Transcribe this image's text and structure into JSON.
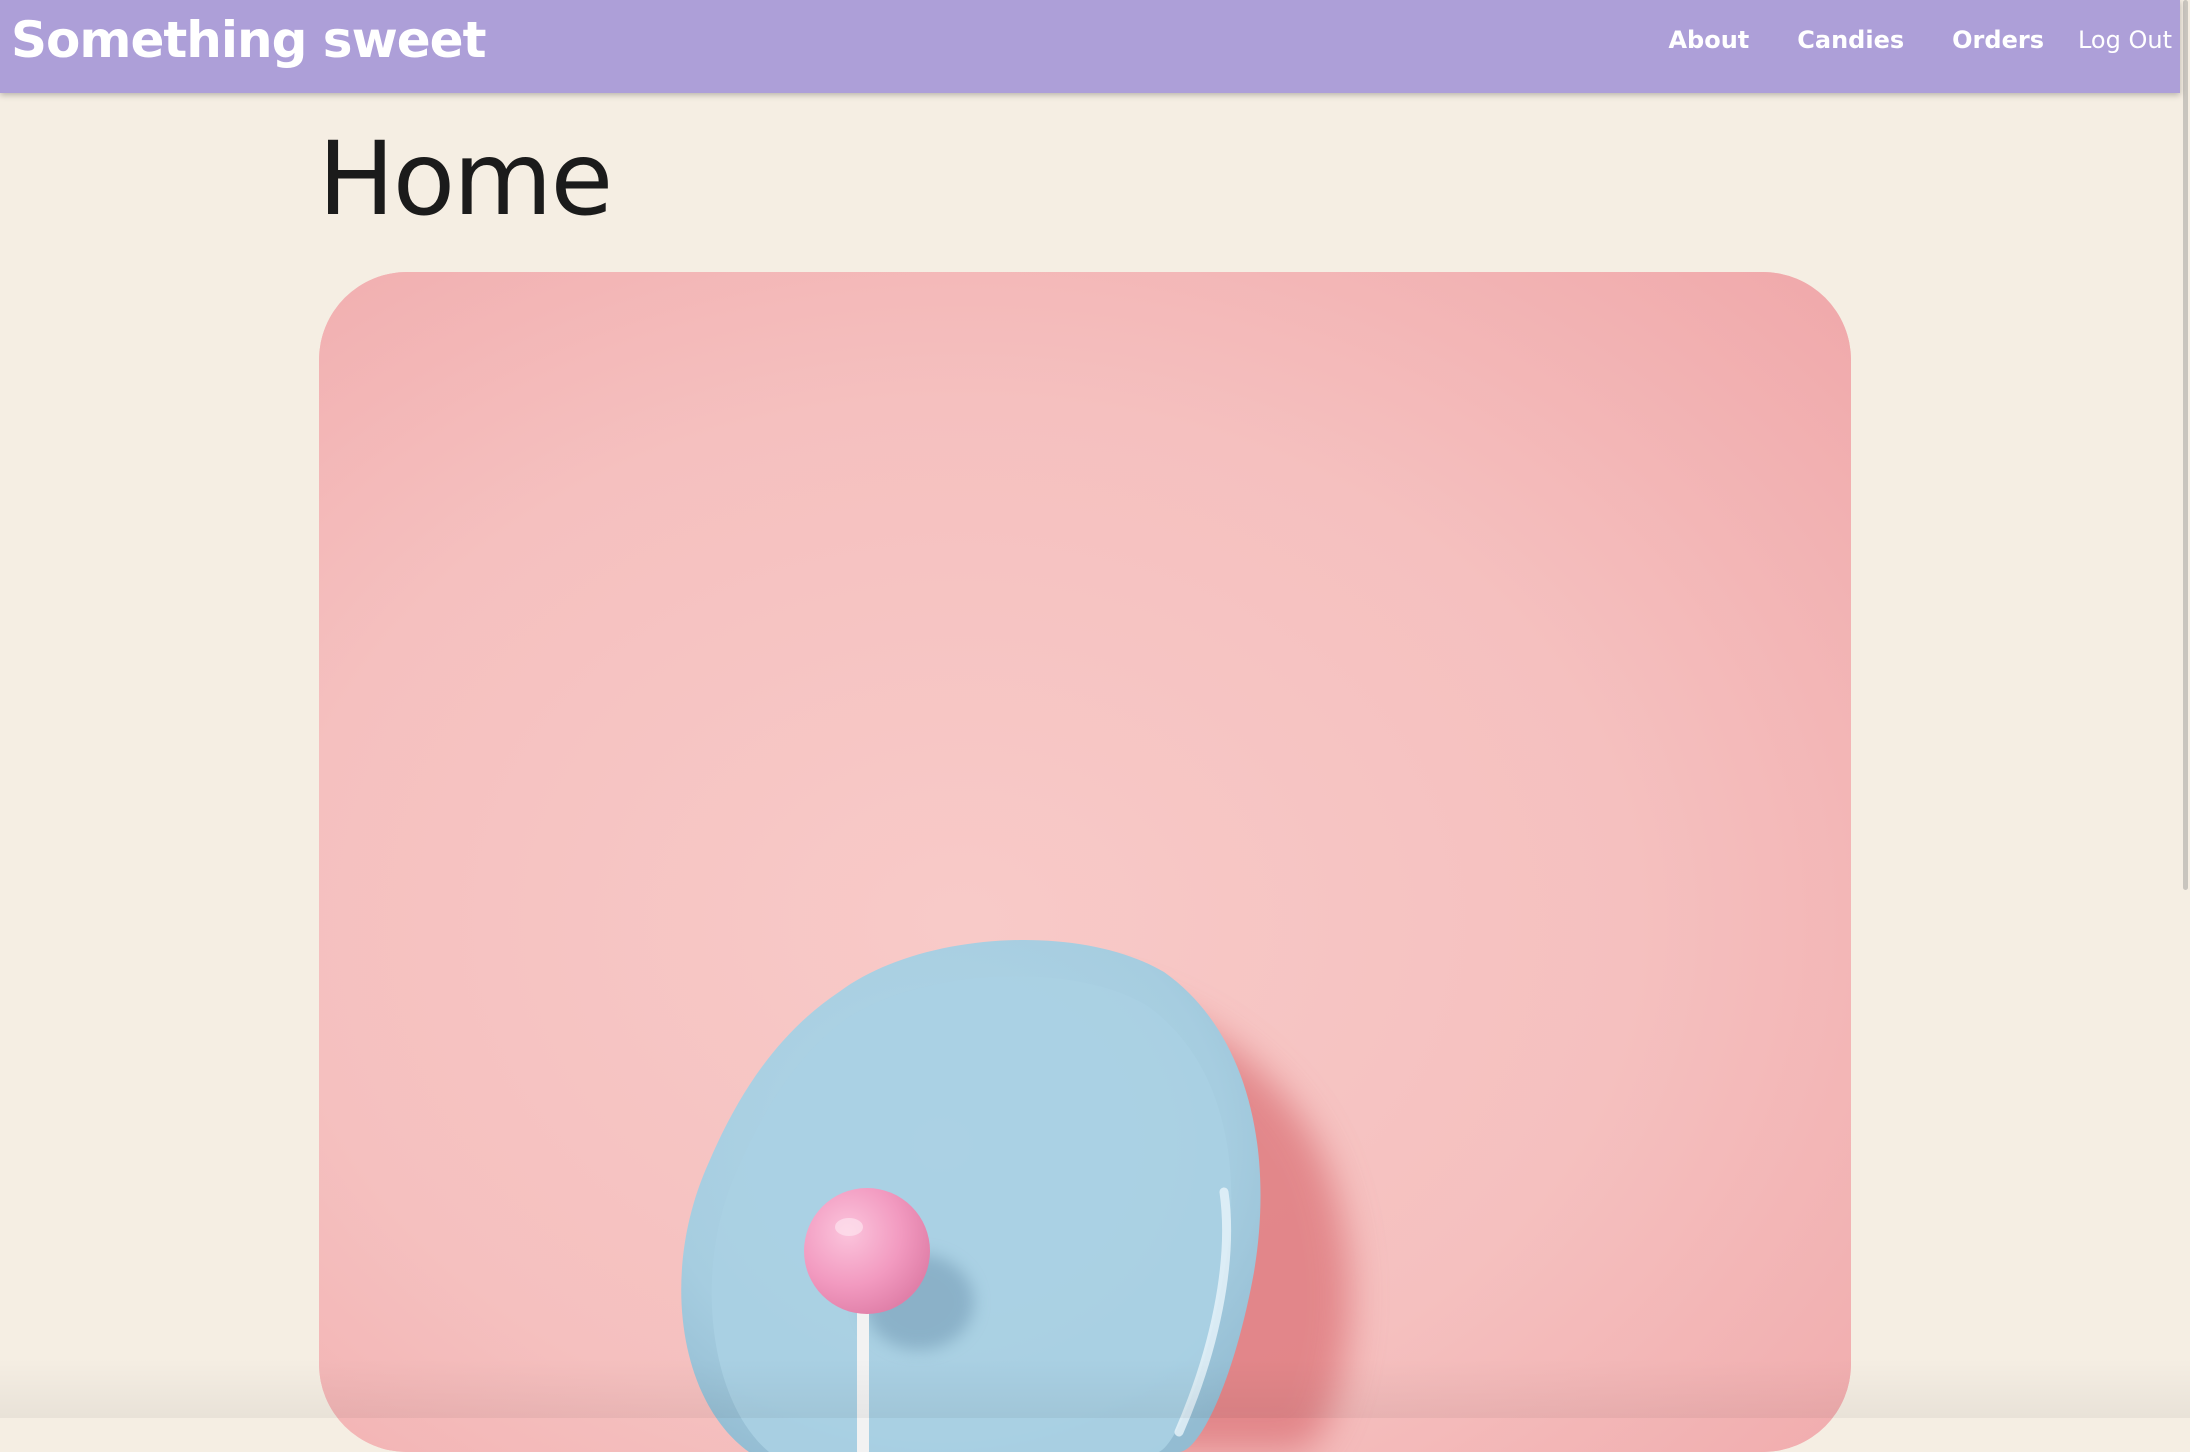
{
  "navbar": {
    "brand": "Something sweet",
    "links": [
      {
        "label": "About"
      },
      {
        "label": "Candies"
      },
      {
        "label": "Orders"
      }
    ],
    "logout_label": "Log Out",
    "background_color": "#ad9fd8"
  },
  "main": {
    "title": "Home",
    "hero_image": {
      "subject": "pink lollipop on light blue plate over pink background",
      "icon": "hero-photo"
    }
  },
  "colors": {
    "page_background": "#f5eee3",
    "nav_background": "#ad9fd8",
    "hero_pink": "#f5c0bf",
    "plate_blue": "#a9d0e2",
    "lollipop_pink": "#f29ac0"
  }
}
